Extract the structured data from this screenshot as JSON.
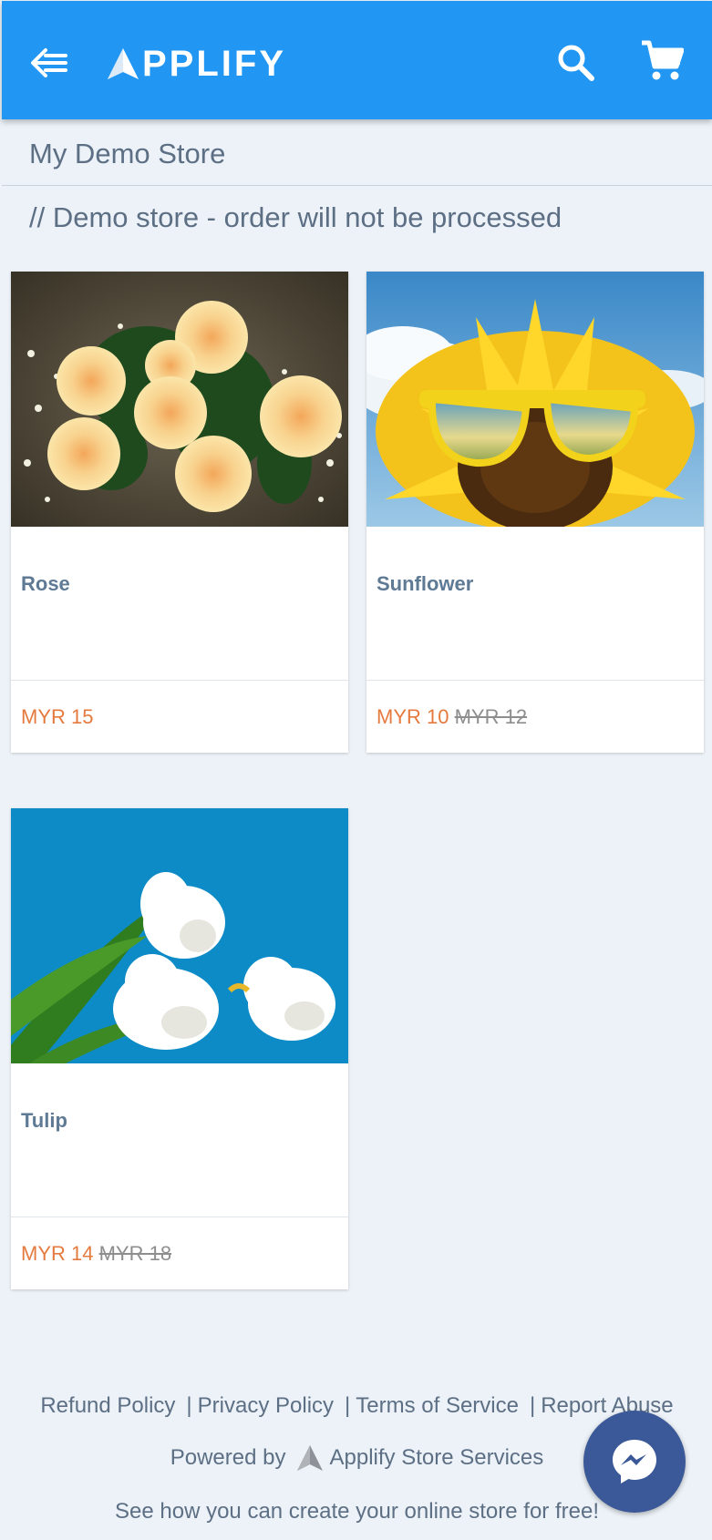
{
  "header": {
    "logo_text": "PPLIFY",
    "menu_icon": "back-menu-icon",
    "search_icon": "search-icon",
    "cart_icon": "cart-icon",
    "color": "#2196f3"
  },
  "store": {
    "name": "My Demo Store",
    "notice": "// Demo store - order will not be processed"
  },
  "products": [
    {
      "name": "Rose",
      "price": "MYR 15",
      "old_price": ""
    },
    {
      "name": "Sunflower",
      "price": "MYR 10",
      "old_price": "MYR 12"
    },
    {
      "name": "Tulip",
      "price": "MYR 14",
      "old_price": "MYR 18"
    }
  ],
  "footer": {
    "links": [
      "Refund Policy",
      "Privacy Policy",
      "Terms of Service",
      "Report Abuse"
    ],
    "powered_by": "Powered by",
    "powered_name": "Applify Store Services",
    "cta": "See how you can create your online store for free!"
  },
  "colors": {
    "price": "#e57a3e",
    "messenger": "#3b5998"
  }
}
